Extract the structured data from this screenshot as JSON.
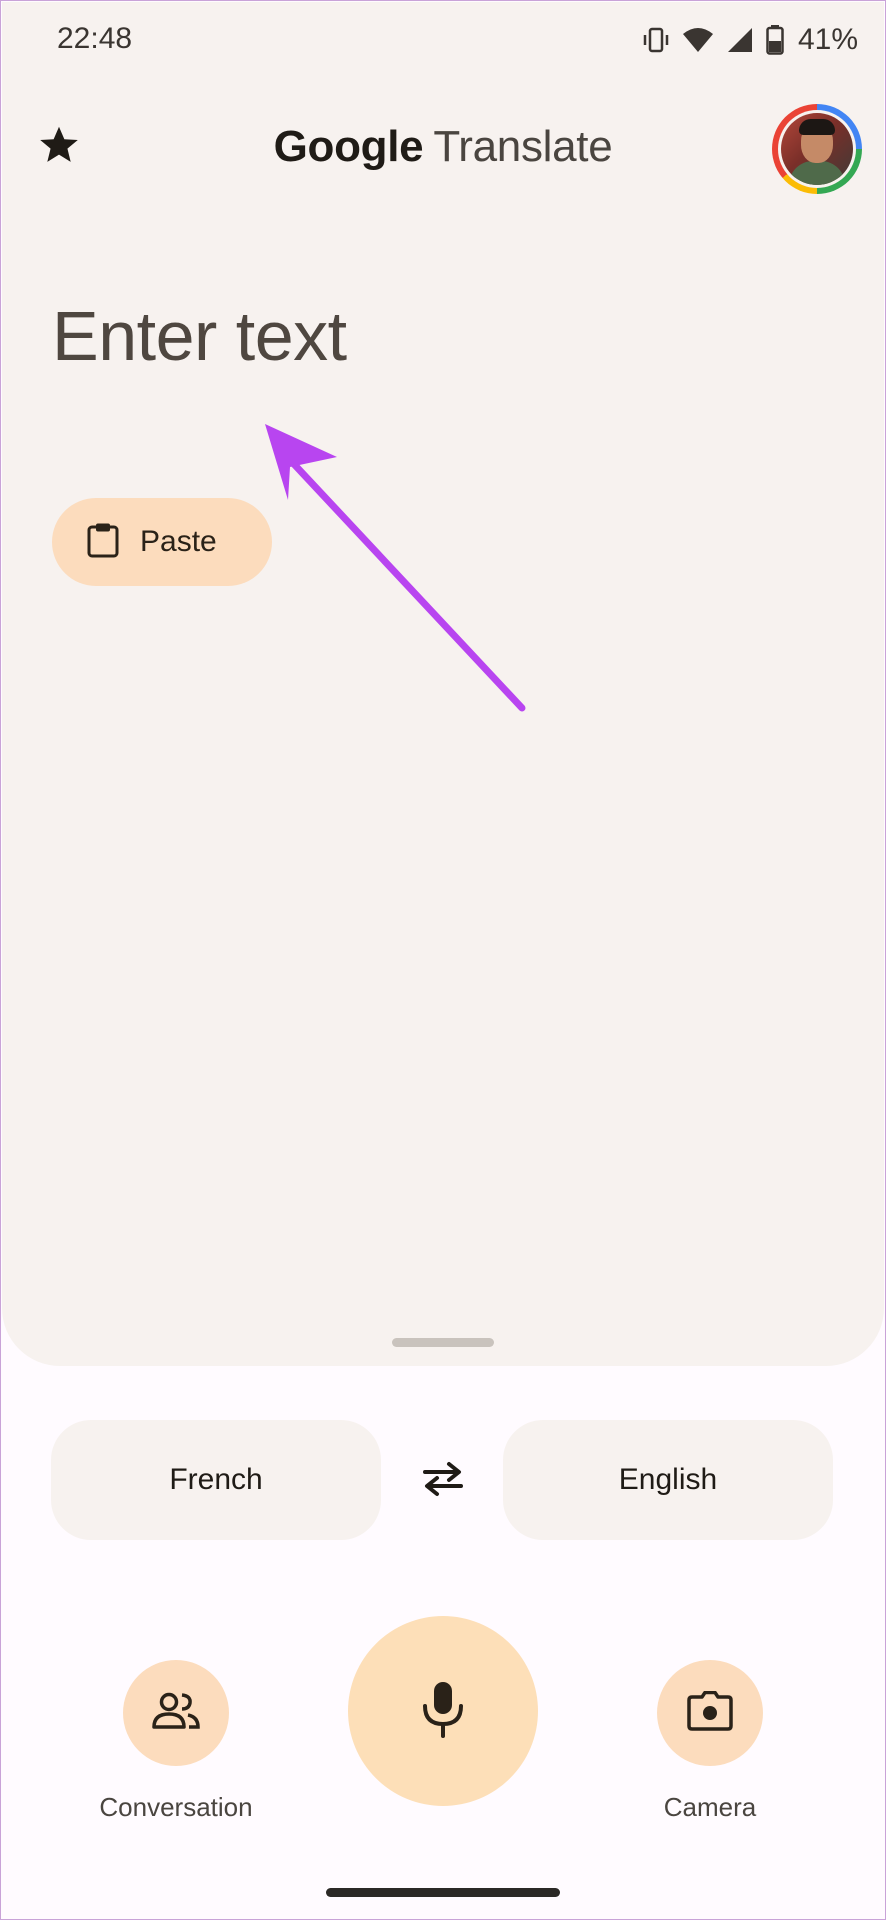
{
  "status_bar": {
    "time": "22:48",
    "battery_percent": "41%",
    "icons": [
      "vibrate-icon",
      "wifi-icon",
      "signal-icon",
      "battery-icon"
    ]
  },
  "app_bar": {
    "title_brand": "Google",
    "title_product": "Translate",
    "saved_icon": "star-icon",
    "account_icon": "avatar"
  },
  "input": {
    "placeholder": "Enter text",
    "paste_label": "Paste",
    "paste_icon": "clipboard-icon"
  },
  "languages": {
    "source": "French",
    "target": "English",
    "swap_icon": "swap-arrows-icon"
  },
  "actions": {
    "conversation_label": "Conversation",
    "conversation_icon": "people-icon",
    "mic_icon": "mic-icon",
    "camera_label": "Camera",
    "camera_icon": "camera-icon"
  },
  "colors": {
    "accent_chip": "#fcdcbd",
    "surface": "#f7f2ef",
    "background": "#fffbff",
    "annotation_arrow": "#b845f0"
  }
}
